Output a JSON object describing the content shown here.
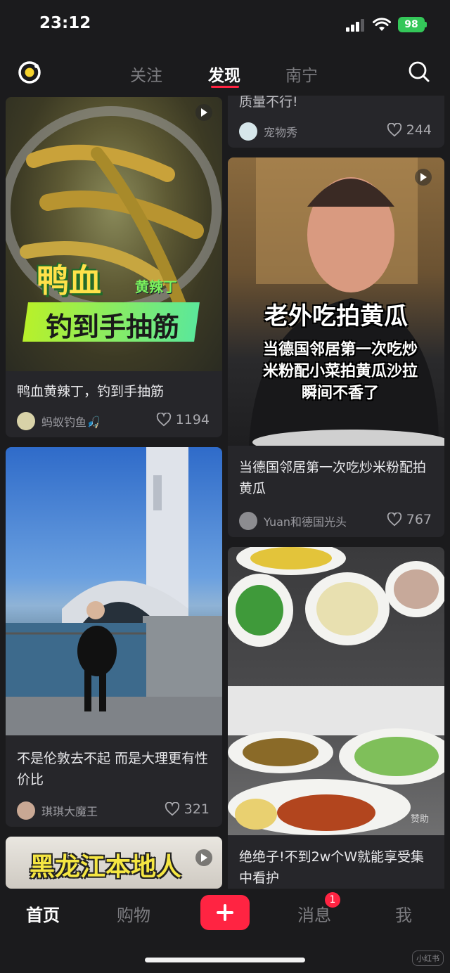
{
  "status_bar": {
    "time": "23:12",
    "battery": "98"
  },
  "top_nav": {
    "tabs": [
      "关注",
      "发现",
      "南宁"
    ],
    "active_tab": "发现"
  },
  "feed": {
    "left": [
      {
        "image_caption_big": "鸭血",
        "image_caption_small": "黄辣丁",
        "image_caption_line2": "钓到手抽筋",
        "title": "鸭血黄辣丁，钓到手抽筋",
        "author": "蚂蚁钓鱼🎣",
        "likes": "1194"
      },
      {
        "title": "不是伦敦去不起 而是大理更有性价比",
        "author": "琪琪大魔王",
        "likes": "321"
      },
      {
        "image_caption_big": "黑龙江本地人"
      }
    ],
    "right": [
      {
        "title": "质量不行!",
        "author": "宠物秀",
        "likes": "244"
      },
      {
        "image_caption_big": "老外吃拍黄瓜",
        "image_caption_sub": "当德国邻居第一次吃炒米粉配小菜拍黄瓜沙拉瞬间不香了",
        "title": "当德国邻居第一次吃炒米粉配拍黄瓜",
        "author": "Yuan和德国光头",
        "likes": "767"
      },
      {
        "sponsor_tag": "赞助",
        "title": "绝绝子!不到2w个W就能享受集中看护"
      }
    ]
  },
  "bottom_nav": {
    "items": [
      "首页",
      "购物",
      "消息",
      "我"
    ],
    "active": "首页",
    "messages_badge": "1"
  },
  "watermark": "小红书",
  "colors": {
    "accent": "#ff2442",
    "background": "#1b1b1d",
    "card": "#26262a"
  }
}
